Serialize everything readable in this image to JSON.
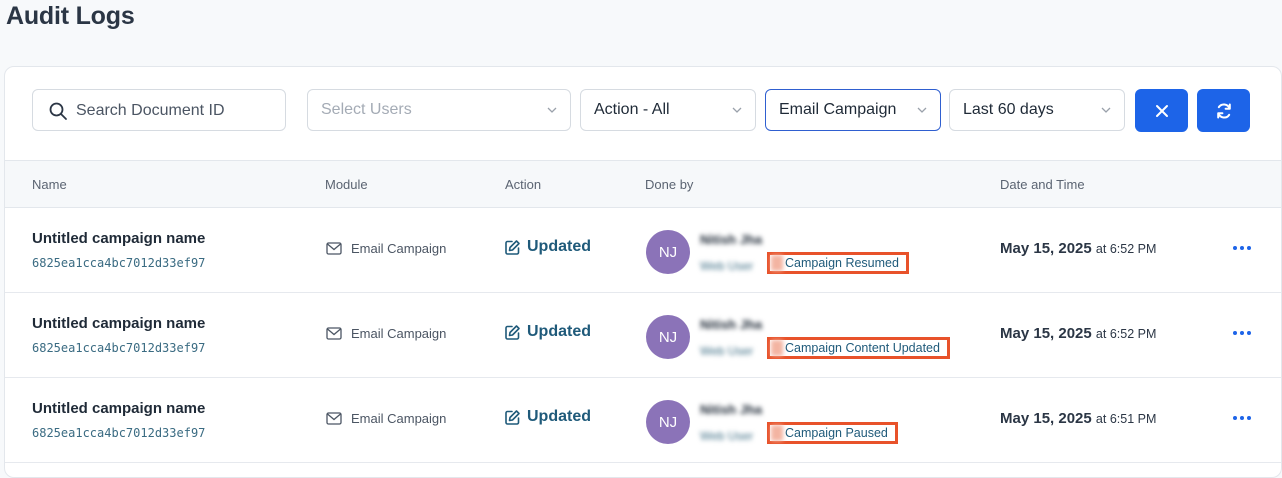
{
  "page": {
    "title": "Audit Logs"
  },
  "filters": {
    "search_placeholder": "Search Document ID",
    "users_placeholder": "Select Users",
    "action_value": "Action - All",
    "module_value": "Email Campaign",
    "date_value": "Last 60 days"
  },
  "table": {
    "headers": {
      "name": "Name",
      "module": "Module",
      "action": "Action",
      "done_by": "Done by",
      "date_time": "Date and Time"
    },
    "rows": [
      {
        "name": "Untitled campaign name",
        "doc_id": "6825ea1cca4bc7012d33ef97",
        "module": "Email Campaign",
        "action": "Updated",
        "initials": "NJ",
        "user_name": "Nitish Jha",
        "user_role": "Web User",
        "event": "Campaign Resumed",
        "date": "May 15, 2025",
        "time": "at 6:52 PM"
      },
      {
        "name": "Untitled campaign name",
        "doc_id": "6825ea1cca4bc7012d33ef97",
        "module": "Email Campaign",
        "action": "Updated",
        "initials": "NJ",
        "user_name": "Nitish Jha",
        "user_role": "Web User",
        "event": "Campaign Content Updated",
        "date": "May 15, 2025",
        "time": "at 6:52 PM"
      },
      {
        "name": "Untitled campaign name",
        "doc_id": "6825ea1cca4bc7012d33ef97",
        "module": "Email Campaign",
        "action": "Updated",
        "initials": "NJ",
        "user_name": "Nitish Jha",
        "user_role": "Web User",
        "event": "Campaign Paused",
        "date": "May 15, 2025",
        "time": "at 6:51 PM"
      }
    ]
  },
  "colors": {
    "primary": "#1d64e8",
    "highlight": "#e8522a",
    "avatar": "#8b73b8",
    "action_text": "#1f5a7a"
  },
  "icons": {
    "search": "search-icon",
    "chevron": "chevron-down-icon",
    "clear": "close-icon",
    "refresh": "refresh-icon",
    "module": "mail-icon",
    "action": "edit-icon",
    "more": "more-horizontal-icon"
  }
}
